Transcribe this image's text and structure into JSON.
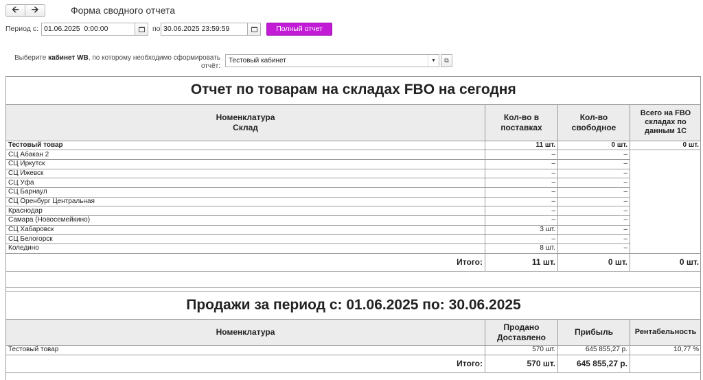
{
  "form": {
    "title": "Форма сводного отчета",
    "back_icon": "arrow-left-icon",
    "forward_icon": "arrow-right-icon",
    "period_from_label": "Период с:",
    "period_from_value": "01.06.2025  0:00:00",
    "period_to_label": "по:",
    "period_to_value": "30.06.2025 23:59:59",
    "full_report_button": "Полный отчет",
    "cabinet_label_pre": "Выберите ",
    "cabinet_label_bold": "кабинет WB",
    "cabinet_label_post": ", по которому необходимо сформировать отчёт:",
    "cabinet_value": "Тестовый кабинет",
    "accent_color": "#c21bd6"
  },
  "stock_report": {
    "title": "Отчет по товарам на складах FBO на сегодня",
    "headers": {
      "nomenclature": "Номенклатура",
      "warehouse": "Склад",
      "in_supplies": "Кол-во в поставках",
      "free": "Кол-во свободное",
      "total_1c": "Всего на FBO складах по данным 1С"
    },
    "product": {
      "name": "Тестовый товар",
      "in_supplies": "11 шт.",
      "free": "0 шт.",
      "total_1c": "0 шт."
    },
    "rows": [
      {
        "name": "СЦ Абакан 2",
        "in_supplies": "–",
        "free": "–"
      },
      {
        "name": "СЦ Иркутск",
        "in_supplies": "–",
        "free": "–"
      },
      {
        "name": "СЦ Ижевск",
        "in_supplies": "–",
        "free": "–"
      },
      {
        "name": "СЦ Уфа",
        "in_supplies": "–",
        "free": "–"
      },
      {
        "name": "СЦ Барнаул",
        "in_supplies": "–",
        "free": "–"
      },
      {
        "name": "СЦ Оренбург Центральная",
        "in_supplies": "–",
        "free": "–"
      },
      {
        "name": "Краснодар",
        "in_supplies": "–",
        "free": "–"
      },
      {
        "name": "Самара (Новосемейкино)",
        "in_supplies": "–",
        "free": "–"
      },
      {
        "name": "СЦ Хабаровск",
        "in_supplies": "3 шт.",
        "free": "–"
      },
      {
        "name": "СЦ Белогорск",
        "in_supplies": "–",
        "free": "–"
      },
      {
        "name": "Коледино",
        "in_supplies": "8 шт.",
        "free": "–"
      }
    ],
    "total": {
      "label": "Итого:",
      "in_supplies": "11 шт.",
      "free": "0 шт.",
      "total_1c": "0 шт."
    }
  },
  "sales_report": {
    "title": "Продажи за период с: 01.06.2025 по: 30.06.2025",
    "headers": {
      "nomenclature": "Номенклатура",
      "sold": "Продано",
      "delivered": "Доставлено",
      "profit": "Прибыль",
      "profitability": "Рентабельность"
    },
    "rows": [
      {
        "name": "Тестовый товар",
        "sold": "570 шт.",
        "profit": "645 855,27 р.",
        "profitability": "10,77 %"
      }
    ],
    "total": {
      "label": "Итого:",
      "sold": "570 шт.",
      "profit": "645 855,27 р."
    }
  }
}
